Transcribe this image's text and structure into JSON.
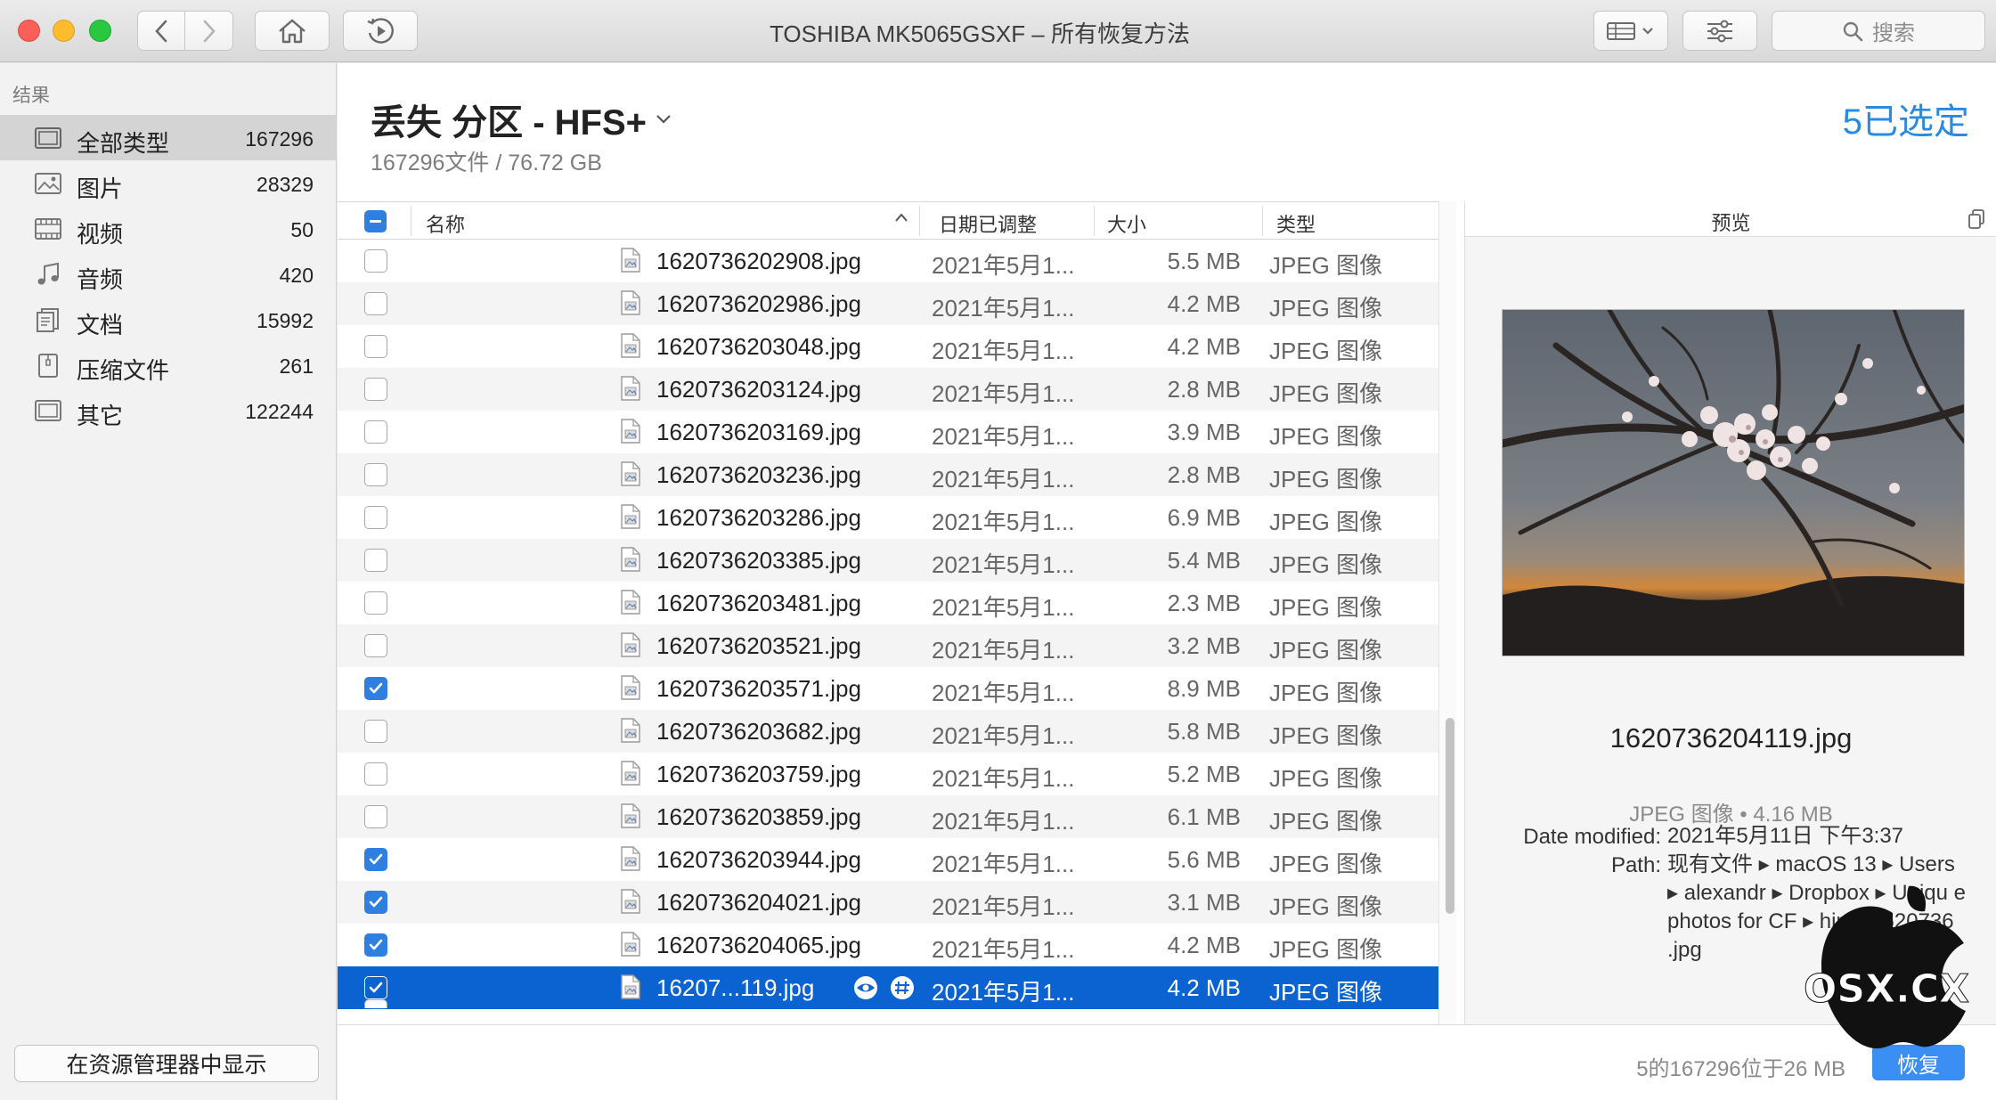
{
  "window": {
    "title": "TOSHIBA MK5065GSXF – 所有恢复方法",
    "search_placeholder": "搜索"
  },
  "sidebar": {
    "heading": "结果",
    "items": [
      {
        "label": "全部类型",
        "count": "167296",
        "icon": "all-types-icon",
        "active": true
      },
      {
        "label": "图片",
        "count": "28329",
        "icon": "picture-icon"
      },
      {
        "label": "视频",
        "count": "50",
        "icon": "video-icon"
      },
      {
        "label": "音频",
        "count": "420",
        "icon": "music-note-icon"
      },
      {
        "label": "文档",
        "count": "15992",
        "icon": "document-icon"
      },
      {
        "label": "压缩文件",
        "count": "261",
        "icon": "archive-icon"
      },
      {
        "label": "其它",
        "count": "122244",
        "icon": "other-icon"
      }
    ],
    "reveal_button": "在资源管理器中显示"
  },
  "main": {
    "title": "丢失 分区 - HFS+",
    "subtitle": "167296文件 / 76.72 GB",
    "selected": "5已选定"
  },
  "table": {
    "columns": {
      "name": "名称",
      "date": "日期已调整",
      "size": "大小",
      "kind": "类型"
    },
    "rows": [
      {
        "name": "1620736202908.jpg",
        "date": "2021年5月1...",
        "size": "5.5 MB",
        "kind": "JPEG 图像",
        "checked": false
      },
      {
        "name": "1620736202986.jpg",
        "date": "2021年5月1...",
        "size": "4.2 MB",
        "kind": "JPEG 图像",
        "checked": false
      },
      {
        "name": "1620736203048.jpg",
        "date": "2021年5月1...",
        "size": "4.2 MB",
        "kind": "JPEG 图像",
        "checked": false
      },
      {
        "name": "1620736203124.jpg",
        "date": "2021年5月1...",
        "size": "2.8 MB",
        "kind": "JPEG 图像",
        "checked": false
      },
      {
        "name": "1620736203169.jpg",
        "date": "2021年5月1...",
        "size": "3.9 MB",
        "kind": "JPEG 图像",
        "checked": false
      },
      {
        "name": "1620736203236.jpg",
        "date": "2021年5月1...",
        "size": "2.8 MB",
        "kind": "JPEG 图像",
        "checked": false
      },
      {
        "name": "1620736203286.jpg",
        "date": "2021年5月1...",
        "size": "6.9 MB",
        "kind": "JPEG 图像",
        "checked": false
      },
      {
        "name": "1620736203385.jpg",
        "date": "2021年5月1...",
        "size": "5.4 MB",
        "kind": "JPEG 图像",
        "checked": false
      },
      {
        "name": "1620736203481.jpg",
        "date": "2021年5月1...",
        "size": "2.3 MB",
        "kind": "JPEG 图像",
        "checked": false
      },
      {
        "name": "1620736203521.jpg",
        "date": "2021年5月1...",
        "size": "3.2 MB",
        "kind": "JPEG 图像",
        "checked": false
      },
      {
        "name": "1620736203571.jpg",
        "date": "2021年5月1...",
        "size": "8.9 MB",
        "kind": "JPEG 图像",
        "checked": true
      },
      {
        "name": "1620736203682.jpg",
        "date": "2021年5月1...",
        "size": "5.8 MB",
        "kind": "JPEG 图像",
        "checked": false
      },
      {
        "name": "1620736203759.jpg",
        "date": "2021年5月1...",
        "size": "5.2 MB",
        "kind": "JPEG 图像",
        "checked": false
      },
      {
        "name": "1620736203859.jpg",
        "date": "2021年5月1...",
        "size": "6.1 MB",
        "kind": "JPEG 图像",
        "checked": false
      },
      {
        "name": "1620736203944.jpg",
        "date": "2021年5月1...",
        "size": "5.6 MB",
        "kind": "JPEG 图像",
        "checked": true
      },
      {
        "name": "1620736204021.jpg",
        "date": "2021年5月1...",
        "size": "3.1 MB",
        "kind": "JPEG 图像",
        "checked": true
      },
      {
        "name": "1620736204065.jpg",
        "date": "2021年5月1...",
        "size": "4.2 MB",
        "kind": "JPEG 图像",
        "checked": true
      },
      {
        "name": "16207...119.jpg",
        "date": "2021年5月1...",
        "size": "4.2 MB",
        "kind": "JPEG 图像",
        "checked": true,
        "selected": true
      }
    ]
  },
  "preview": {
    "header": "预览",
    "filename": "1620736204119.jpg",
    "kind_size": "JPEG 图像 • 4.16 MB",
    "date_label": "Date modified:",
    "date_value": "2021年5月11日 下午3:37",
    "path_label": "Path:",
    "path_value": "现有文件 ▸ macOS 13 ▸ Users ▸ alexandr ▸ Dropbox ▸ Uniqu e photos for CF ▸ hin ▸ 1620736 .jpg"
  },
  "watermark": "OSX.CX",
  "status": {
    "text": "5的167296位于26 MB",
    "recover_button": "恢复"
  },
  "colors": {
    "accent": "#2a8ae0",
    "selection": "#0a63d0",
    "checkbox": "#2f7fe0"
  }
}
